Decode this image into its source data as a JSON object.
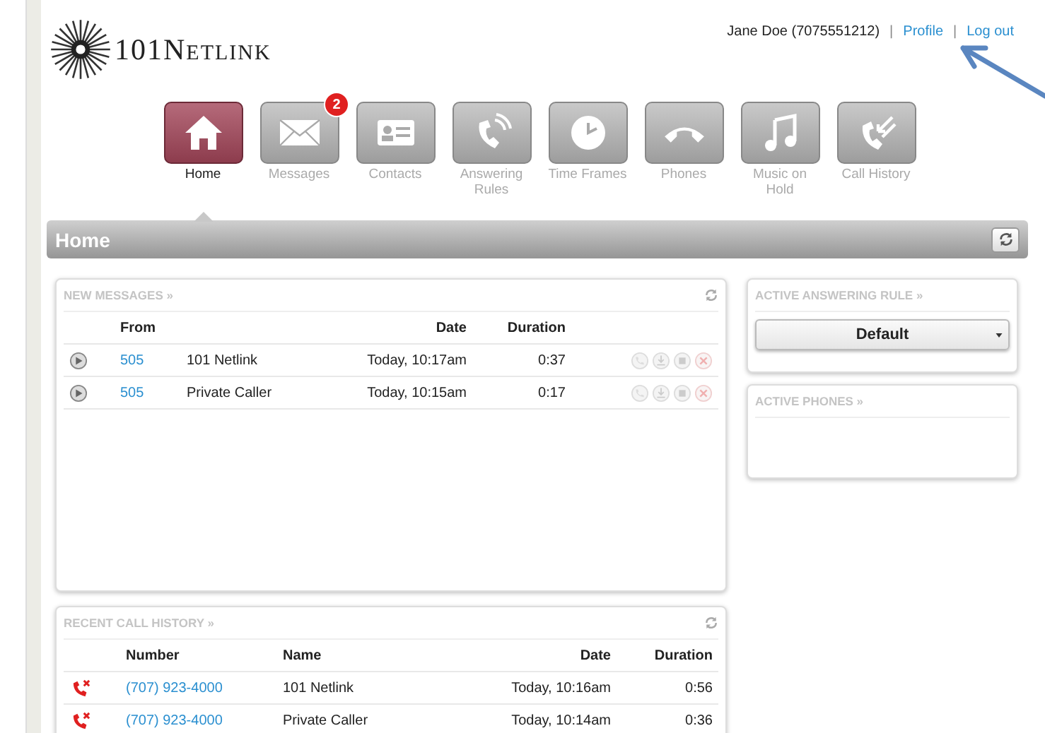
{
  "logo": {
    "text": "101Netlink"
  },
  "user_bar": {
    "user": "Jane Doe (7075551212)",
    "separator_1": "|",
    "profile_link": "Profile",
    "separator_2": "|",
    "logout_link": "Log out"
  },
  "nav": [
    {
      "label": "Home",
      "kind": "home",
      "selected": true
    },
    {
      "label": "Messages",
      "kind": "mail",
      "selected": false,
      "badge": "2"
    },
    {
      "label": "Contacts",
      "kind": "card",
      "selected": false
    },
    {
      "label": "Answering Rules",
      "kind": "rules",
      "selected": false
    },
    {
      "label": "Time Frames",
      "kind": "clock",
      "selected": false
    },
    {
      "label": "Phones",
      "kind": "phone",
      "selected": false
    },
    {
      "label": "Music on Hold",
      "kind": "music",
      "selected": false
    },
    {
      "label": "Call History",
      "kind": "history",
      "selected": false
    }
  ],
  "page_title": "Home",
  "new_messages": {
    "title": "NEW MESSAGES »",
    "columns": [
      "From",
      "Date",
      "Duration"
    ],
    "rows": [
      {
        "from": "505",
        "name": "101 Netlink",
        "date": "Today, 10:17am",
        "duration": "0:37"
      },
      {
        "from": "505",
        "name": "Private Caller",
        "date": "Today, 10:15am",
        "duration": "0:17"
      }
    ]
  },
  "recent_call_history": {
    "title": "RECENT CALL HISTORY »",
    "columns": [
      "Number",
      "Name",
      "Date",
      "Duration"
    ],
    "rows": [
      {
        "number": "(707) 923-4000",
        "name": "101 Netlink",
        "date": "Today, 10:16am",
        "duration": "0:56"
      },
      {
        "number": "(707) 923-4000",
        "name": "Private Caller",
        "date": "Today, 10:14am",
        "duration": "0:36"
      }
    ]
  },
  "active_answering_rule": {
    "title": "ACTIVE ANSWERING RULE »",
    "value": "Default"
  },
  "active_phones": {
    "title": "ACTIVE PHONES »"
  }
}
